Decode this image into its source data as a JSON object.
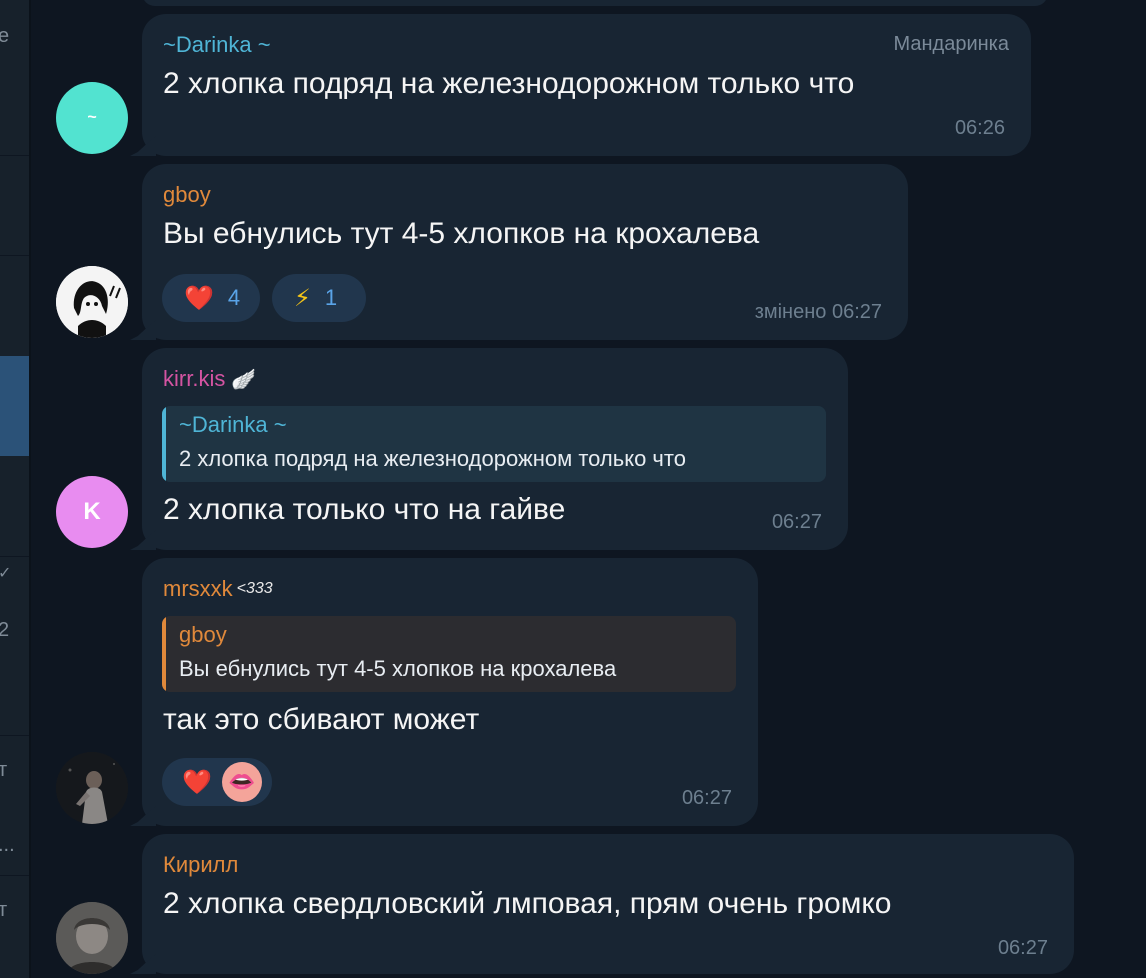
{
  "sidebar": {
    "fragments": [
      {
        "label": "e"
      },
      {
        "label": "✓"
      },
      {
        "label": "2"
      },
      {
        "label": "т"
      },
      {
        "label": "..."
      },
      {
        "label": "т"
      }
    ]
  },
  "messages": [
    {
      "sender": "~Darinka ~",
      "sender_color": "#4fb5d6",
      "admin_title": "Мандаринка",
      "text": "2 хлопка подряд на железнодорожном только что",
      "time": "06:26",
      "avatar_letter": "~",
      "avatar_color": "#52e3d0"
    },
    {
      "sender": "gboy",
      "sender_color": "#e0893b",
      "text": "Вы ебнулись тут 4-5 хлопков на крохалева",
      "time": "змінено 06:27",
      "reactions": [
        {
          "emoji": "❤️",
          "count": "4"
        },
        {
          "emoji": "⚡",
          "count": "1"
        }
      ]
    },
    {
      "sender": "kirr.kis",
      "sender_color": "#d454a2",
      "sender_badge": "🪽",
      "reply": {
        "name": "~Darinka ~",
        "text": "2 хлопка подряд на железнодорожном только что",
        "color": "#4fb5d6",
        "bg": "#1f3443"
      },
      "text": "2 хлопка только что на гайве",
      "time": "06:27",
      "avatar_letter": "K",
      "avatar_color": "#e88cf0"
    },
    {
      "sender": "mrsxxk",
      "sender_badge": "<333",
      "sender_color": "#e0893b",
      "reply": {
        "name": "gboy",
        "text": "Вы ебнулись тут 4-5 хлопков на крохалева",
        "color": "#e0893b",
        "bg": "#2c2c30"
      },
      "text": "так это сбивают может",
      "time": "06:27",
      "reactions": [
        {
          "emoji": "❤️"
        },
        {
          "emoji": "👄"
        }
      ]
    },
    {
      "sender": "Кирилл",
      "sender_color": "#e0893b",
      "text": "2 хлопка свердловский лмповая, прям очень громко",
      "time": "06:27"
    }
  ]
}
